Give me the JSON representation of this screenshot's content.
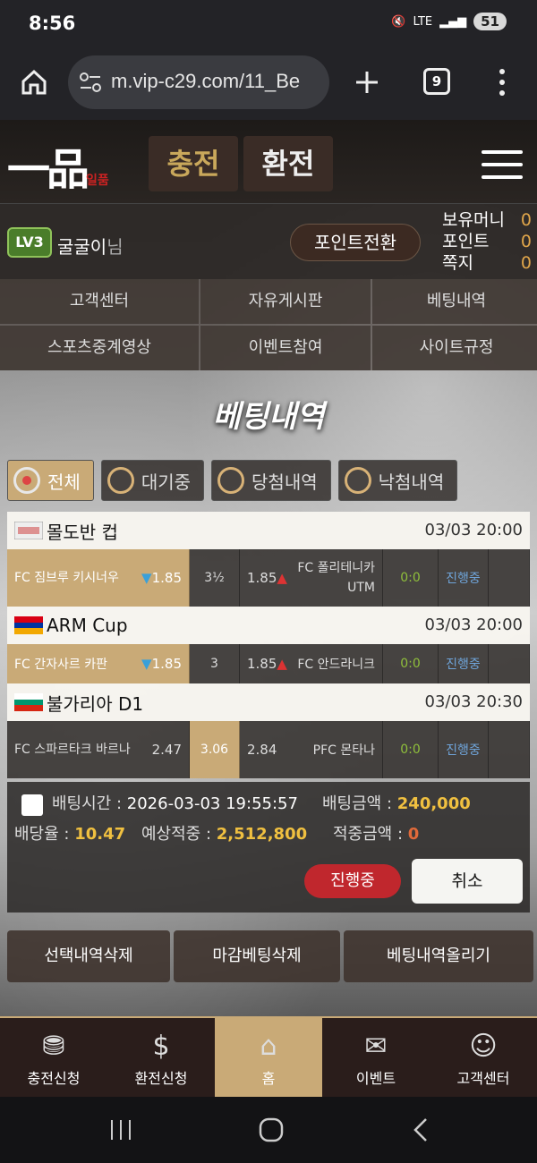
{
  "status": {
    "time": "8:56",
    "lte": "LTE",
    "battery": "51"
  },
  "browser": {
    "url": "m.vip-c29.com/11_Be",
    "tabs": "9"
  },
  "header": {
    "logo": "一品",
    "logo_sub": "일품",
    "charge": "충전",
    "exchange": "환전"
  },
  "user": {
    "level": "LV3",
    "name": "굴굴이",
    "honorific": "님",
    "point_button": "포인트전환",
    "balances": [
      {
        "label": "보유머니",
        "value": "0"
      },
      {
        "label": "포인트",
        "value": "0"
      },
      {
        "label": "쪽지",
        "value": "0"
      }
    ]
  },
  "menu": [
    "고객센터",
    "자유게시판",
    "베팅내역",
    "스포츠중계영상",
    "이벤트참여",
    "사이트규정"
  ],
  "page_title": "베팅내역",
  "filters": [
    {
      "label": "전체",
      "active": true
    },
    {
      "label": "대기중"
    },
    {
      "label": "당첨내역"
    },
    {
      "label": "낙첨내역"
    }
  ],
  "bets": [
    {
      "league": "몰도반 컵",
      "time": "03/03 20:00",
      "home": "FC 짐브루 키시너우",
      "home_odds": "1.85",
      "line": "3½",
      "away_odds": "1.85",
      "away": "FC 폴리테니카 UTM",
      "score": "0:0",
      "status": "진행중"
    },
    {
      "league": "ARM Cup",
      "time": "03/03 20:00",
      "home": "FC 간자사르 카판",
      "home_odds": "1.85",
      "line": "3",
      "away_odds": "1.85",
      "away": "FC 안드라니크",
      "score": "0:0",
      "status": "진행중"
    },
    {
      "league": "불가리아 D1",
      "time": "03/03 20:30",
      "home": "FC 스파르타크 바르나",
      "home_odds": "2.47",
      "line": "3.06",
      "away_odds": "2.84",
      "away": "PFC 몬타나",
      "score": "0:0",
      "status": "진행중"
    }
  ],
  "summary": {
    "bet_time_label": "배팅시간 :",
    "bet_time": "2026-03-03 19:55:57",
    "bet_amount_label": "배팅금액 :",
    "bet_amount": "240,000",
    "odds_label": "배당율 :",
    "odds": "10.47",
    "expected_label": "예상적중 :",
    "expected": "2,512,800",
    "win_label": "적중금액 :",
    "win": "0",
    "status_btn": "진행중",
    "cancel_btn": "취소"
  },
  "actions": [
    "선택내역삭제",
    "마감베팅삭제",
    "베팅내역올리기"
  ],
  "bottom_nav": [
    "충전신청",
    "환전신청",
    "홈",
    "이벤트",
    "고객센터"
  ]
}
